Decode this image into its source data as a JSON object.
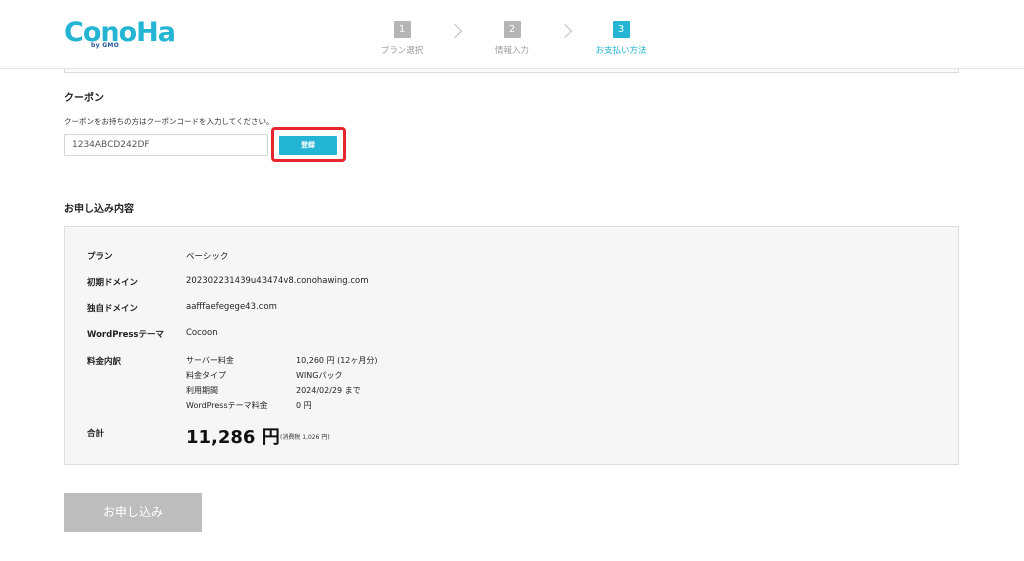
{
  "header": {
    "logo_text": "ConoHa",
    "logo_sub": "by GMO",
    "steps": [
      {
        "number": "1",
        "label": "プラン選択",
        "state": "inactive"
      },
      {
        "number": "2",
        "label": "情報入力",
        "state": "inactive"
      },
      {
        "number": "3",
        "label": "お支払い方法",
        "state": "active"
      }
    ]
  },
  "coupon": {
    "title": "クーポン",
    "hint": "クーポンをお持ちの方はクーポンコードを入力してください。",
    "input_value": "1234ABCD242DF",
    "register_label": "登録"
  },
  "order": {
    "title": "お申し込み内容",
    "rows": [
      {
        "label": "プラン",
        "value": "ベーシック"
      },
      {
        "label": "初期ドメイン",
        "value": "202302231439u43474v8.conohawing.com"
      },
      {
        "label": "独自ドメイン",
        "value": "aafffaefegege43.com"
      },
      {
        "label": "WordPressテーマ",
        "value": "Cocoon"
      }
    ],
    "fees": {
      "label": "料金内訳",
      "items": [
        {
          "name": "サーバー料金",
          "value": "10,260 円 (12ヶ月分)"
        },
        {
          "name": "料金タイプ",
          "value": "WINGパック"
        },
        {
          "name": "利用期間",
          "value": "2024/02/29 まで"
        },
        {
          "name": "WordPressテーマ料金",
          "value": "0 円"
        }
      ]
    },
    "total": {
      "label": "合計",
      "amount": "11,286 円",
      "tax_note": "(消費税 1,026 円)"
    }
  },
  "submit_label": "お申し込み",
  "colors": {
    "accent": "#23b5d3",
    "highlight": "#e8262d",
    "disabled": "#bdbdbd"
  }
}
